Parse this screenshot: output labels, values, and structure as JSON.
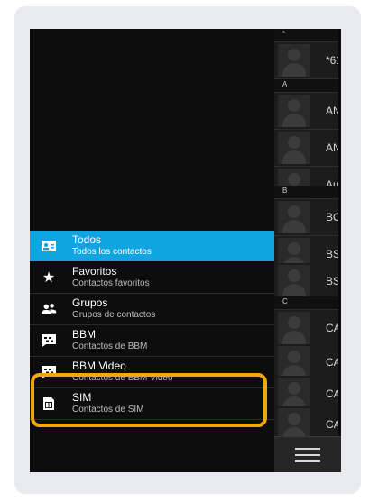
{
  "drawer": {
    "items": [
      {
        "title": "Todos",
        "subtitle": "Todos los contactos",
        "icon": "contact-card-icon",
        "active": true
      },
      {
        "title": "Favoritos",
        "subtitle": "Contactos favoritos",
        "icon": "star-icon",
        "active": false
      },
      {
        "title": "Grupos",
        "subtitle": "Grupos de contactos",
        "icon": "group-icon",
        "active": false
      },
      {
        "title": "BBM",
        "subtitle": "Contactos de BBM",
        "icon": "bbm-icon",
        "active": false
      },
      {
        "title": "BBM Video",
        "subtitle": "Contactos de BBM Video",
        "icon": "bbm-video-icon",
        "active": false
      },
      {
        "title": "SIM",
        "subtitle": "Contactos de SIM",
        "icon": "sim-card-icon",
        "active": false
      }
    ]
  },
  "contacts": {
    "sections": [
      {
        "letter": "*",
        "names": [
          "*61"
        ]
      },
      {
        "letter": "A",
        "names": [
          "AN",
          "AN",
          "Au"
        ]
      },
      {
        "letter": "B",
        "names": [
          "BO",
          "BS",
          "BS"
        ]
      },
      {
        "letter": "C",
        "names": [
          "CA",
          "CA",
          "CA",
          "CA"
        ]
      }
    ]
  },
  "colors": {
    "accent": "#10a5e0",
    "highlight": "#f2a60f",
    "background": "#0d0d0d"
  },
  "menu_icon": "hamburger-menu-icon"
}
